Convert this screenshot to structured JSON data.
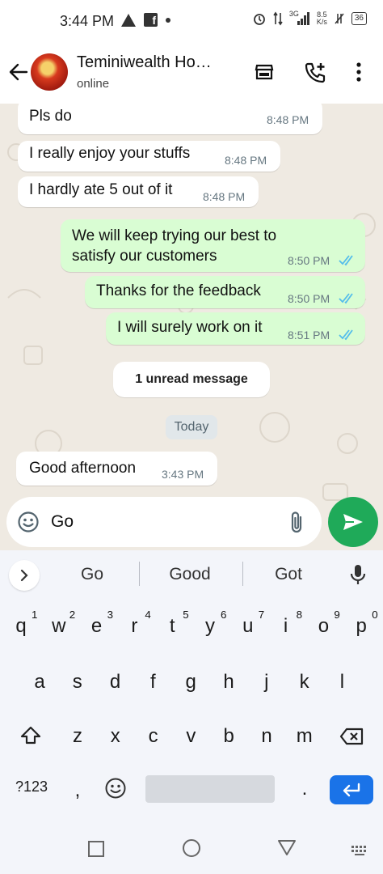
{
  "status_bar": {
    "time": "3:44 PM",
    "network": "3G",
    "speed": "8.5",
    "speed_unit": "K/s",
    "battery": "36"
  },
  "header": {
    "contact_name": "Teminiwealth Ho…",
    "contact_status": "online"
  },
  "messages": [
    {
      "dir": "in",
      "text": "Pls do",
      "time": "8:48 PM"
    },
    {
      "dir": "in",
      "text": "I really enjoy your stuffs",
      "time": "8:48 PM"
    },
    {
      "dir": "in",
      "text": "I hardly ate 5 out of it",
      "time": "8:48 PM"
    },
    {
      "dir": "out",
      "text_line1": "We will keep trying our best to",
      "text_line2": "satisfy our customers",
      "time": "8:50 PM"
    },
    {
      "dir": "out",
      "text": "Thanks for the feedback",
      "time": "8:50 PM"
    },
    {
      "dir": "out",
      "text": "I will surely work on it",
      "time": "8:51 PM"
    }
  ],
  "unread_label": "1 unread message",
  "date_label": "Today",
  "new_message": {
    "text": "Good afternoon",
    "time": "3:43 PM"
  },
  "composer": {
    "value": "Go"
  },
  "keyboard": {
    "suggestions": [
      "Go",
      "Good",
      "Got"
    ],
    "row1": [
      "q",
      "w",
      "e",
      "r",
      "t",
      "y",
      "u",
      "i",
      "o",
      "p"
    ],
    "row1_hints": [
      "1",
      "2",
      "3",
      "4",
      "5",
      "6",
      "7",
      "8",
      "9",
      "0"
    ],
    "row2": [
      "a",
      "s",
      "d",
      "f",
      "g",
      "h",
      "j",
      "k",
      "l"
    ],
    "row3": [
      "z",
      "x",
      "c",
      "v",
      "b",
      "n",
      "m"
    ],
    "symbols_label": "?123",
    "comma": ",",
    "period": "."
  },
  "colors": {
    "chat_bg": "#efeae2",
    "outgoing": "#d9fdd3",
    "send": "#1faa59",
    "ticks": "#53bdeb",
    "enter": "#1a73e8"
  }
}
